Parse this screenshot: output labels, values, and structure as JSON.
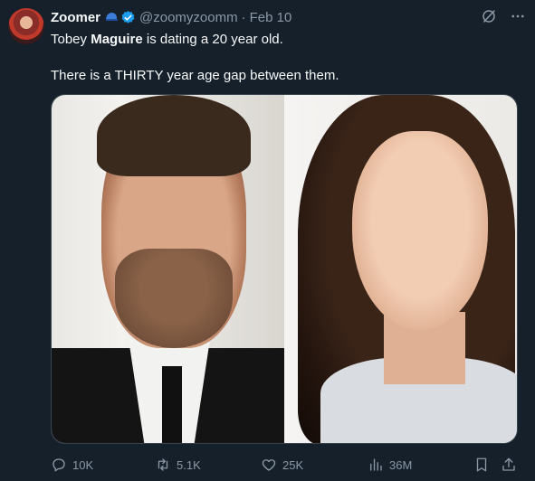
{
  "author": {
    "name": "Zoomer",
    "handle": "@zoomyzoomm",
    "separator": "·",
    "date": "Feb 10"
  },
  "tweet": {
    "line1_prefix": "Tobey ",
    "line1_bold": "Maguire",
    "line1_suffix": " is dating a 20 year old.",
    "line2": "There is a THIRTY year age gap between them."
  },
  "actions": {
    "replies": "10K",
    "retweets": "5.1K",
    "likes": "25K",
    "views": "36M"
  },
  "colors": {
    "background": "#15202b",
    "text": "#f7f9f9",
    "muted": "#8b98a5",
    "verified": "#1d9bf0"
  },
  "icons": [
    "grok-icon",
    "more-icon",
    "reply-icon",
    "retweet-icon",
    "like-icon",
    "views-icon",
    "bookmark-icon",
    "share-icon"
  ]
}
